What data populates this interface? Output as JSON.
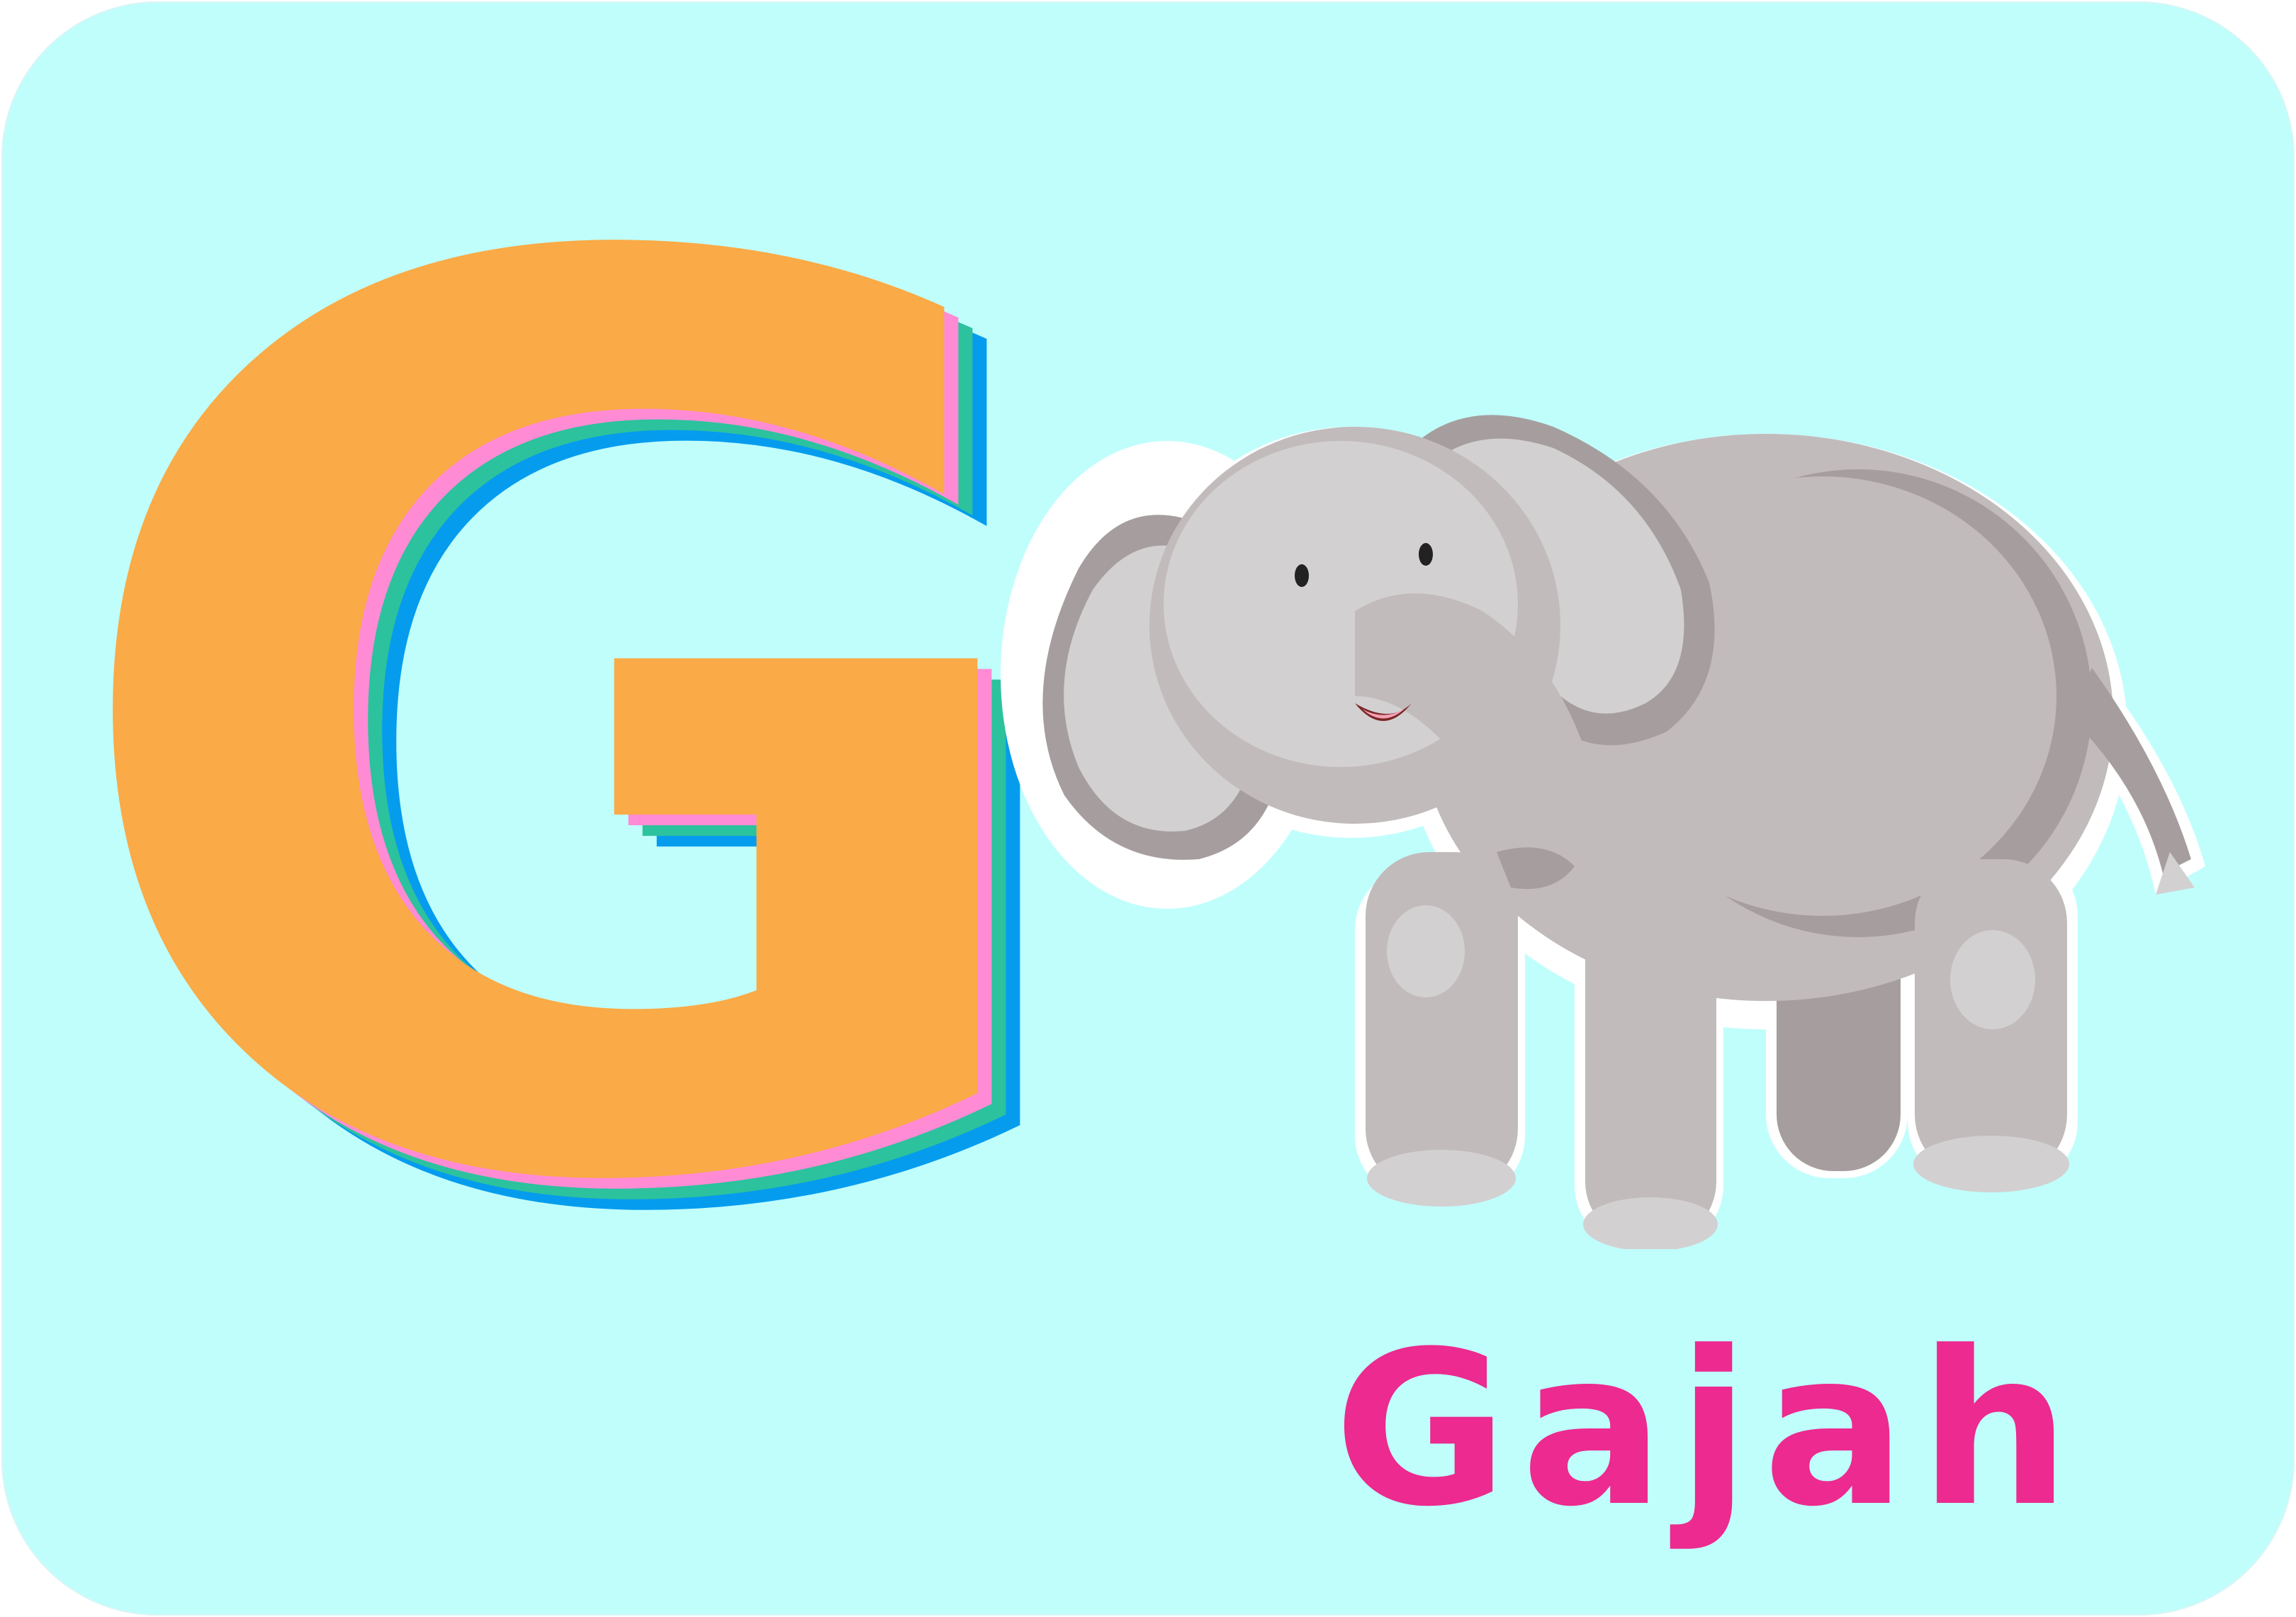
{
  "card": {
    "background_color": "#C0FEFC"
  },
  "letter": {
    "char": "G",
    "face_color": "#FAAA46",
    "layer_colors": [
      "#FF8BD5",
      "#2CC29D",
      "#059CEE"
    ]
  },
  "illustration": {
    "subject_icon": "elephant-icon",
    "body_color": "#C2BBBB",
    "shadow_color": "#A69E9E",
    "ear_color": "#D3D0D1",
    "outline_color": "#FFFFFF"
  },
  "word": {
    "text": "Gajah",
    "color": "#EC2A8F"
  }
}
